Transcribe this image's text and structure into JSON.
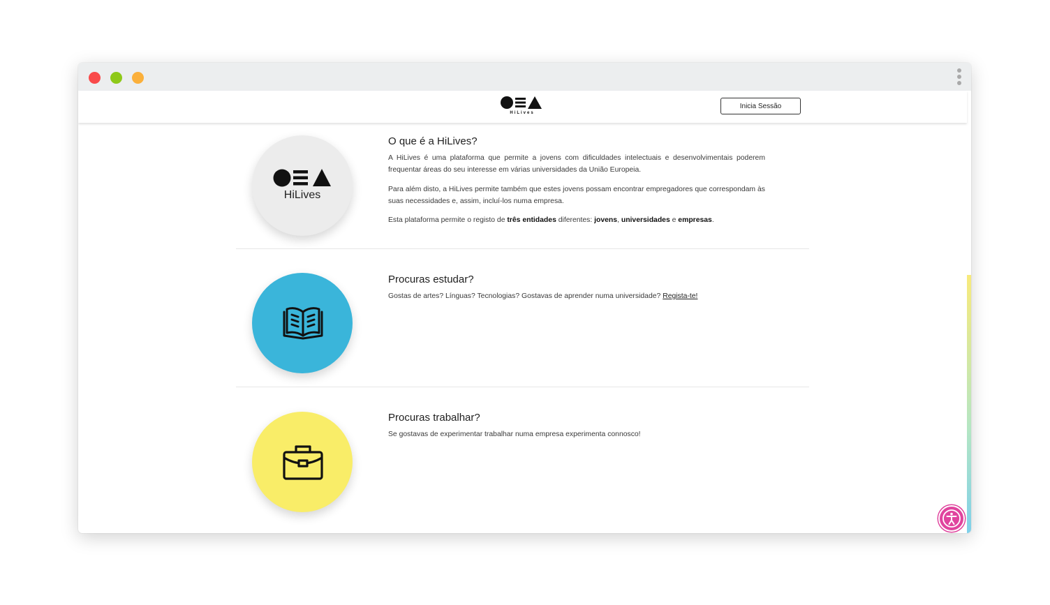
{
  "window": {
    "traffic_lights": {
      "close": "#f94a4a",
      "minimize": "#8ec919",
      "maximize": "#fbb03b"
    }
  },
  "header": {
    "logo_word": "HiLives",
    "login_button": "Inicia Sessão"
  },
  "sections": {
    "about": {
      "logo_word": "HiLives",
      "title": "O que é a HiLives?",
      "p1": "A HiLives é uma plataforma que permite a jovens com dificuldades intelectuais e desenvolvimentais poderem frequentar áreas do seu interesse em várias universidades da União Europeia.",
      "p2": "Para além disto, a HiLives permite também que estes jovens possam encontrar empregadores que correspondam às suas necessidades e, assim, incluí-los numa empresa.",
      "p3": {
        "t1": "Esta plataforma permite o registo de ",
        "b1": "três entidades",
        "t2": " diferentes: ",
        "b2": "jovens",
        "t3": ", ",
        "b3": "universidades",
        "t4": " e ",
        "b4": "empresas",
        "t5": "."
      },
      "circle_color": "#ececec"
    },
    "study": {
      "title": "Procuras estudar?",
      "text": "Gostas de artes? Línguas? Tecnologias? Gostavas de aprender numa universidade? ",
      "link": "Regista-te!",
      "icon": "open-book-icon",
      "circle_color": "#3ab5da"
    },
    "work": {
      "title": "Procuras trabalhar?",
      "text": "Se gostavas de experimentar trabalhar numa empresa experimenta connosco!",
      "icon": "briefcase-icon",
      "circle_color": "#f9ed68"
    }
  },
  "accessibility_button": {
    "icon": "accessibility-icon",
    "color": "#e0449e"
  }
}
